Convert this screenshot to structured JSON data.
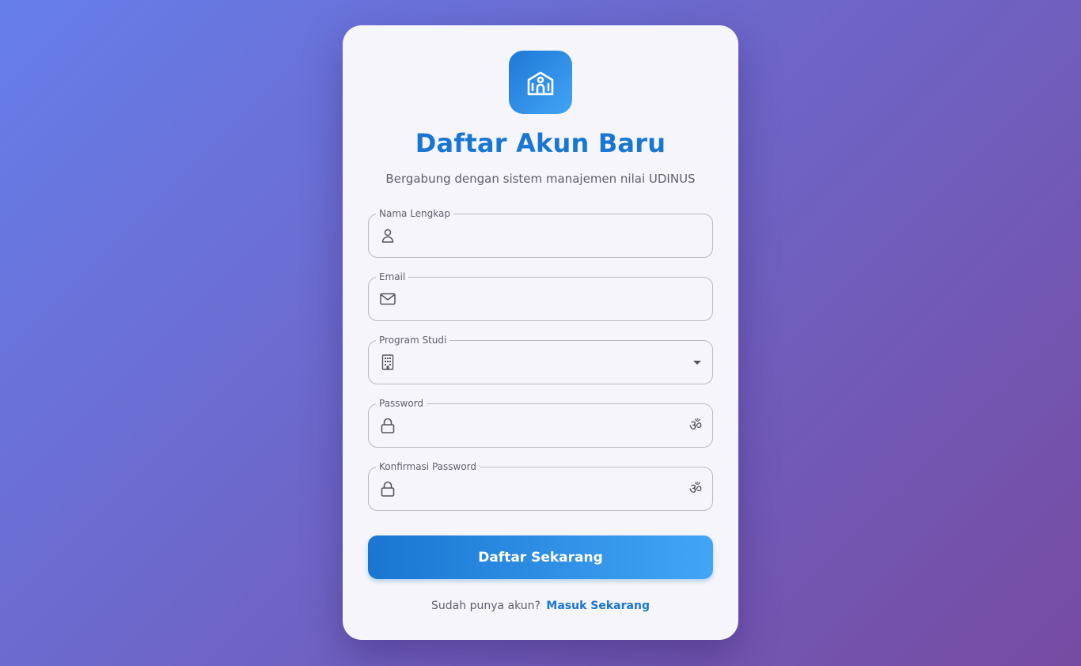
{
  "app": {
    "title": "Daftar Akun Baru",
    "subtitle": "Bergabung dengan sistem manajemen nilai UDINUS",
    "logo_icon": "school-icon",
    "accent_color": "#1976d2"
  },
  "form": {
    "fields": [
      {
        "label": "Nama Lengkap",
        "value": "",
        "icon": "person-icon",
        "type": "text"
      },
      {
        "label": "Email",
        "value": "",
        "icon": "email-icon",
        "type": "email"
      },
      {
        "label": "Program Studi",
        "value": "",
        "icon": "building-icon",
        "type": "select"
      },
      {
        "label": "Password",
        "value": "",
        "icon": "lock-icon",
        "type": "password",
        "trailing_icon": "visibility-toggle-icon"
      },
      {
        "label": "Konfirmasi Password",
        "value": "",
        "icon": "lock-icon",
        "type": "password",
        "trailing_icon": "visibility-toggle-icon"
      }
    ],
    "submit_label": "Daftar Sekarang"
  },
  "footer": {
    "prompt": "Sudah punya akun?",
    "link_label": "Masuk Sekarang"
  }
}
